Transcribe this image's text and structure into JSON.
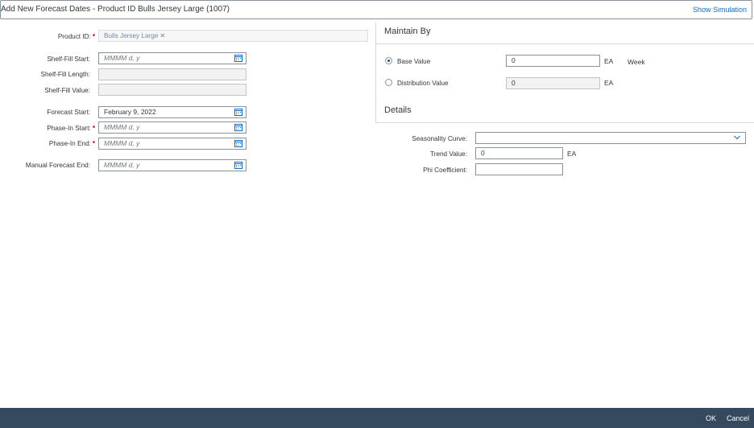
{
  "header": {
    "title": "Add New Forecast Dates - Product ID Bulls Jersey Large (1007)",
    "show_simulation": "Show Simulation"
  },
  "left_form": {
    "product_id": {
      "label": "Product ID:",
      "token": "Bulls Jersey Large"
    },
    "shelf_fill_start": {
      "label": "Shelf-Fill Start:",
      "placeholder": "MMMM d, y"
    },
    "shelf_fill_length": {
      "label": "Shelf-Fill Length:",
      "value": ""
    },
    "shelf_fill_value": {
      "label": "Shelf-Fill Value:",
      "value": ""
    },
    "forecast_start": {
      "label": "Forecast Start:",
      "value": "February 9, 2022"
    },
    "phase_in_start": {
      "label": "Phase-In Start:",
      "placeholder": "MMMM d, y"
    },
    "phase_in_end": {
      "label": "Phase-In End:",
      "placeholder": "MMMM d, y"
    },
    "manual_forecast_end": {
      "label": "Manual Forecast End:",
      "placeholder": "MMMM d, y"
    },
    "required_marker": "*"
  },
  "maintain_by": {
    "title": "Maintain By",
    "base_value": {
      "label": "Base Value",
      "value": "0",
      "unit": "EA",
      "period": "Week",
      "selected": true
    },
    "distribution_value": {
      "label": "Distribution Value",
      "value": "0",
      "unit": "EA",
      "selected": false
    }
  },
  "details": {
    "title": "Details",
    "seasonality_curve": {
      "label": "Seasonality Curve:",
      "value": ""
    },
    "trend_value": {
      "label": "Trend Value:",
      "value": "0",
      "unit": "EA"
    },
    "phi_coefficient": {
      "label": "Phi Coefficient:",
      "value": ""
    }
  },
  "footer": {
    "ok": "OK",
    "cancel": "Cancel"
  },
  "colors": {
    "link": "#0a6ed1",
    "required": "#bb0000",
    "footer_bg": "#354a5f",
    "radio_selected": "#0854a0"
  }
}
